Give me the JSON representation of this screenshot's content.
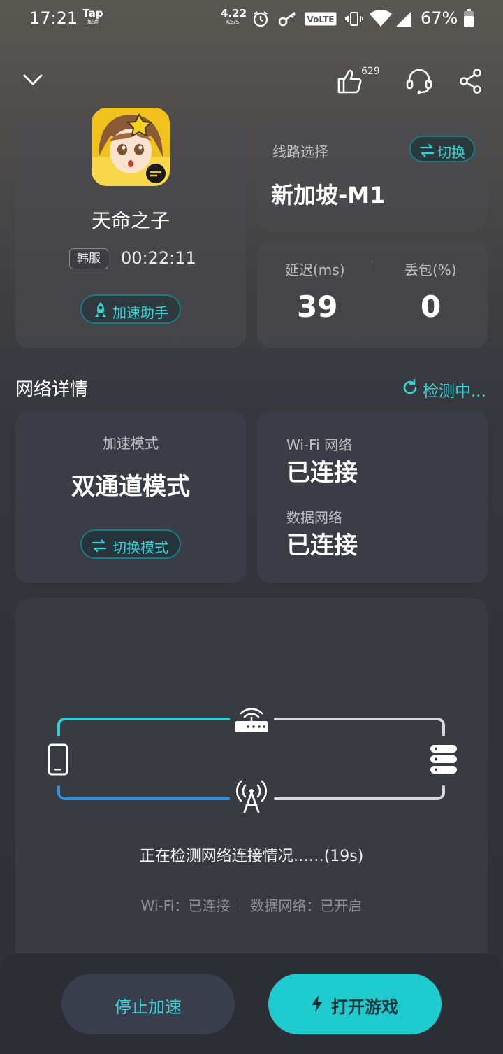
{
  "status_bar": {
    "time": "17:21",
    "app_badge_line1": "Tap",
    "app_badge_line2": "加速",
    "net_speed_value": "4.22",
    "net_speed_unit": "KB/S",
    "volte": "VoLTE",
    "battery": "67%"
  },
  "header": {
    "like_count": "629"
  },
  "game": {
    "name": "天命之子",
    "region": "韩服",
    "timer": "00:22:11",
    "assistant_label": "加速助手"
  },
  "route": {
    "label": "线路选择",
    "switch_label": "切换",
    "value": "新加坡-M1"
  },
  "stats": {
    "latency_label": "延迟(ms)",
    "latency_value": "39",
    "loss_label": "丢包(%)",
    "loss_value": "0"
  },
  "network": {
    "section_title": "网络详情",
    "detecting_label": "检测中...",
    "mode_label": "加速模式",
    "mode_value": "双通道模式",
    "mode_switch_label": "切换模式",
    "wifi_label": "Wi-Fi 网络",
    "wifi_value": "已连接",
    "data_label": "数据网络",
    "data_value": "已连接"
  },
  "diagram": {
    "detect_text": "正在检测网络连接情况……(19s)",
    "wifi_status": "Wi-Fi：已连接",
    "data_status": "数据网络：已开启",
    "colors": {
      "wifi_path": "#2fd0d6",
      "cell_path": "#2f8fe0",
      "server_path": "#d9d9dc"
    }
  },
  "bottom": {
    "stop_label": "停止加速",
    "open_label": "打开游戏"
  },
  "colors": {
    "accent": "#36d3d9",
    "primary_button": "#1ecbcf"
  }
}
